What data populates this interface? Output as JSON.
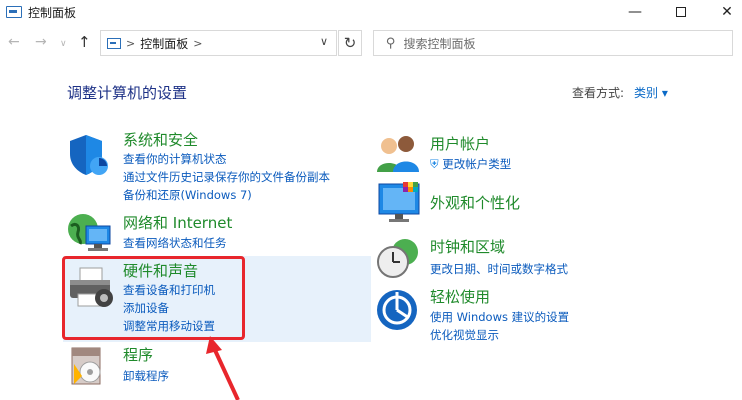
{
  "window": {
    "title": "控制面板",
    "minimize_glyph": "—",
    "close_glyph": "✕"
  },
  "nav": {
    "back_glyph": "←",
    "forward_glyph": "→",
    "recent_glyph": "∨",
    "up_glyph": "↑",
    "refresh_glyph": "↻",
    "address_separator": ">",
    "address_text": "控制面板",
    "address_trailing_separator": ">",
    "address_dropdown_glyph": "∨",
    "search_placeholder": "搜索控制面板"
  },
  "header": {
    "title": "调整计算机的设置",
    "view_by_label": "查看方式:",
    "view_by_value": "类别 ▾"
  },
  "categories_left": [
    {
      "title": "系统和安全",
      "links": [
        "查看你的计算机状态",
        "通过文件历史记录保存你的文件备份副本",
        "备份和还原(Windows 7)"
      ],
      "icon": "shield-icon"
    },
    {
      "title": "网络和 Internet",
      "links": [
        "查看网络状态和任务"
      ],
      "icon": "network-icon"
    },
    {
      "title": "硬件和声音",
      "links": [
        "查看设备和打印机",
        "添加设备",
        "调整常用移动设置"
      ],
      "icon": "printer-icon"
    },
    {
      "title": "程序",
      "links": [
        "卸载程序"
      ],
      "icon": "programs-icon"
    }
  ],
  "categories_right": [
    {
      "title": "用户帐户",
      "links": [
        "更改帐户类型"
      ],
      "icon": "users-icon"
    },
    {
      "title": "外观和个性化",
      "links": [],
      "icon": "display-icon"
    },
    {
      "title": "时钟和区域",
      "links": [
        "更改日期、时间或数字格式"
      ],
      "icon": "clock-icon"
    },
    {
      "title": "轻松使用",
      "links": [
        "使用 Windows 建议的设置",
        "优化视觉显示"
      ],
      "icon": "ease-of-access-icon"
    }
  ],
  "colors": {
    "category_title": "#1f8a2b",
    "link": "#0b5bbd",
    "highlight": "#e7f1fb",
    "annotation_red": "#e8262c"
  }
}
